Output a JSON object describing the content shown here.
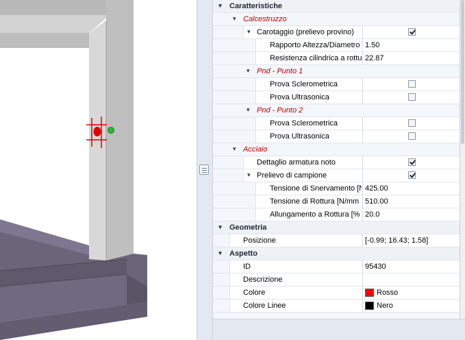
{
  "grid": {
    "categories": {
      "caratteristiche": "Caratteristiche",
      "geometria": "Geometria",
      "aspetto": "Aspetto"
    },
    "calcestruzzo": {
      "label": "Calcestruzzo",
      "carotaggio": {
        "label": "Carotaggio (prelievo provino)",
        "checked": true
      },
      "rapporto": {
        "label": "Rapporto Altezza/Diametro",
        "value": "1.50"
      },
      "resistenza": {
        "label": "Resistenza cilindrica a rottur",
        "value": "22.87"
      },
      "pnd1": {
        "label": "Pnd - Punto 1",
        "sclerometrica": {
          "label": "Prova Sclerometrica",
          "checked": false
        },
        "ultrasonica": {
          "label": "Prova Ultrasonica",
          "checked": false
        }
      },
      "pnd2": {
        "label": "Pnd - Punto 2",
        "sclerometrica": {
          "label": "Prova Sclerometrica",
          "checked": false
        },
        "ultrasonica": {
          "label": "Prova Ultrasonica",
          "checked": false
        }
      }
    },
    "acciaio": {
      "label": "Acciaio",
      "dettaglio": {
        "label": "Dettaglio armatura noto",
        "checked": true
      },
      "prelievo": {
        "label": "Prelievo di campione",
        "checked": true
      },
      "snervamento": {
        "label": "Tensione di Snervamento  [N",
        "value": "425.00"
      },
      "rottura": {
        "label": "Tensione di Rottura  [N/mm",
        "value": "510.00"
      },
      "allungamento": {
        "label": "Allungamento a Rottura  [%",
        "value": "20.0"
      }
    },
    "geometria": {
      "posizione": {
        "label": "Posizione",
        "value": "[-0.99; 16.43; 1.58]"
      }
    },
    "aspetto": {
      "id": {
        "label": "ID",
        "value": "95430"
      },
      "descrizione": {
        "label": "Descrizione",
        "value": ""
      },
      "colore": {
        "label": "Colore",
        "value": "Rosso",
        "swatch": "#ff0000"
      },
      "colore_linee": {
        "label": "Colore Linee",
        "value": "Nero",
        "swatch": "#000000"
      }
    }
  },
  "icons": {
    "collapse": "▾"
  },
  "colors": {
    "sub_heading": "#c00000",
    "marker_red": "#e00000",
    "marker_green": "#2fb52f",
    "column_gray": "#c8c8c8",
    "floor_purple": "#6a6478"
  }
}
